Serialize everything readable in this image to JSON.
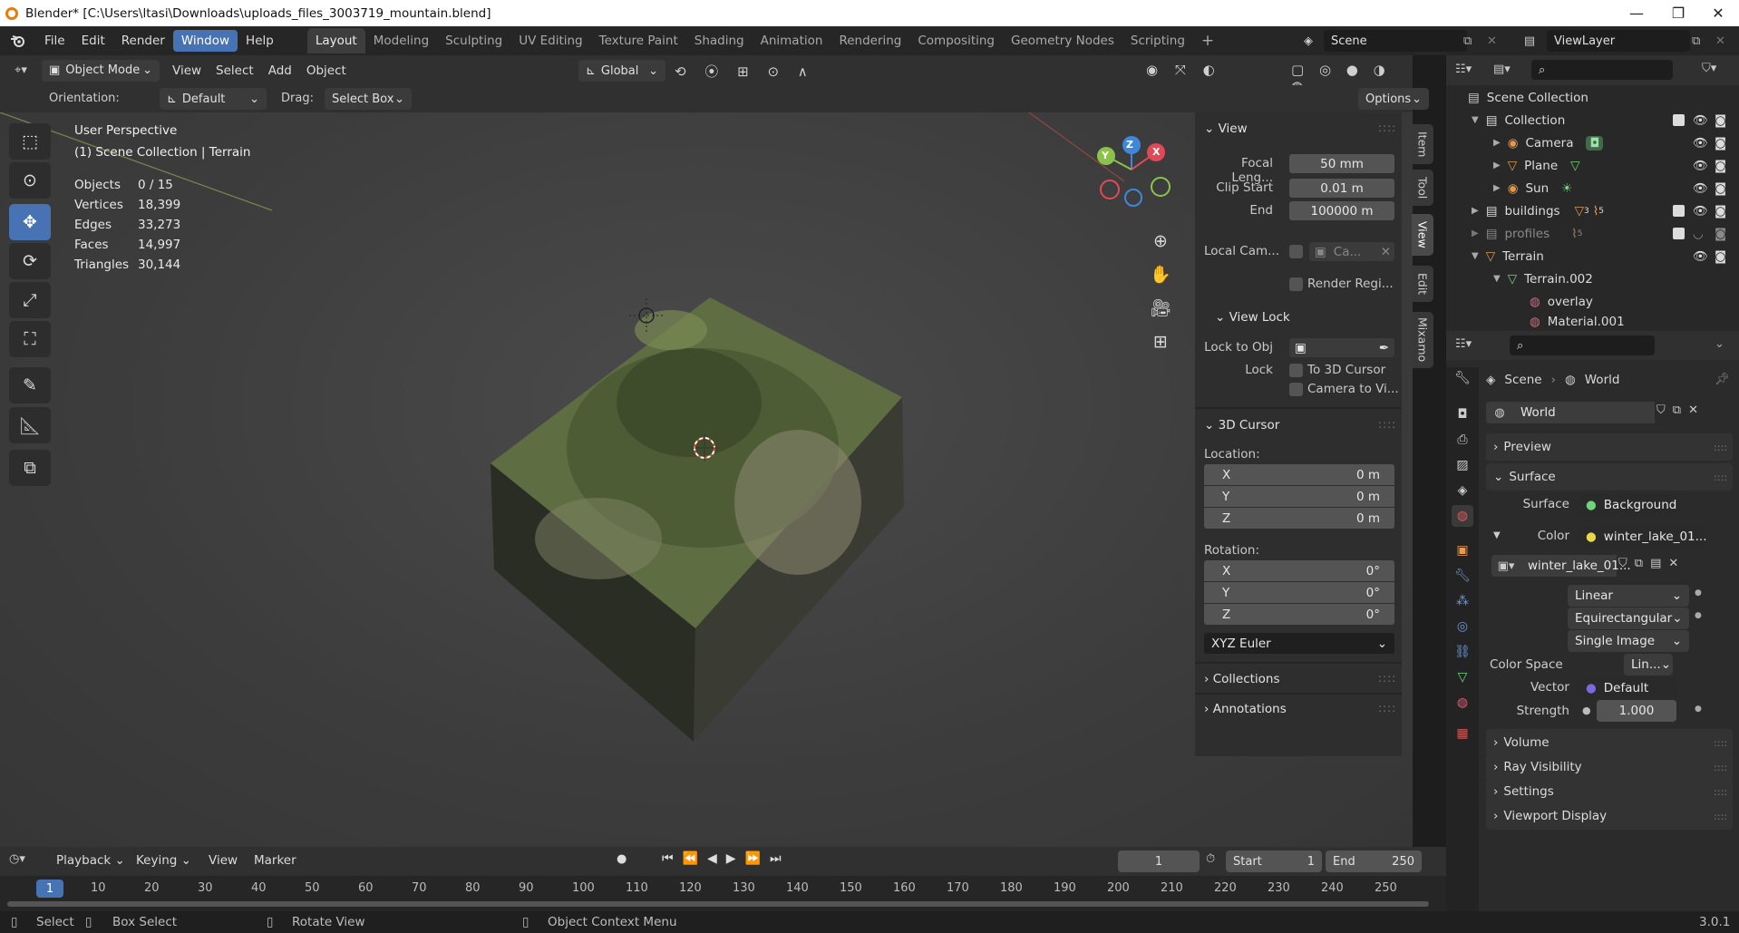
{
  "titlebar": {
    "title": "Blender* [C:\\Users\\ltasi\\Downloads\\uploads_files_3003719_mountain.blend]",
    "min": "—",
    "max": "❐",
    "close": "✕"
  },
  "menu": [
    "File",
    "Edit",
    "Render",
    "Window",
    "Help"
  ],
  "menu_active": "Window",
  "workspaces": [
    "Layout",
    "Modeling",
    "Sculpting",
    "UV Editing",
    "Texture Paint",
    "Shading",
    "Animation",
    "Rendering",
    "Compositing",
    "Geometry Nodes",
    "Scripting"
  ],
  "workspace_add": "+",
  "scene_name": "Scene",
  "view_layer": "ViewLayer",
  "vp_header": {
    "mode": "Object Mode",
    "view": "View",
    "select": "Select",
    "add": "Add",
    "object": "Object",
    "transform": "Global"
  },
  "vp_header2": {
    "orientation_label": "Orientation:",
    "orientation": "Default",
    "drag_label": "Drag:",
    "drag": "Select Box",
    "options": "Options"
  },
  "overlay": {
    "perspective": "User Perspective",
    "collection": "(1) Scene Collection | Terrain",
    "stats": [
      {
        "label": "Objects",
        "value": "0 / 15"
      },
      {
        "label": "Vertices",
        "value": "18,399"
      },
      {
        "label": "Edges",
        "value": "33,273"
      },
      {
        "label": "Faces",
        "value": "14,997"
      },
      {
        "label": "Triangles",
        "value": "30,144"
      }
    ]
  },
  "gizmo": {
    "x": "X",
    "y": "Y",
    "z": "Z"
  },
  "npanel": {
    "view_title": "View",
    "focal_label": "Focal Leng...",
    "focal_value": "50 mm",
    "clip_start_label": "Clip Start",
    "clip_start_value": "0.01 m",
    "clip_end_label": "End",
    "clip_end_value": "100000 m",
    "local_cam_label": "Local Cam...",
    "local_cam_value": "Ca...",
    "render_region": "Render Regi...",
    "view_lock_title": "View Lock",
    "lock_obj_label": "Lock to Obj",
    "lock_label": "Lock",
    "to_cursor": "To 3D Cursor",
    "camera_to_view": "Camera to Vi...",
    "cursor_title": "3D Cursor",
    "location_label": "Location:",
    "loc": [
      {
        "axis": "X",
        "value": "0 m"
      },
      {
        "axis": "Y",
        "value": "0 m"
      },
      {
        "axis": "Z",
        "value": "0 m"
      }
    ],
    "rotation_label": "Rotation:",
    "rot": [
      {
        "axis": "X",
        "value": "0°"
      },
      {
        "axis": "Y",
        "value": "0°"
      },
      {
        "axis": "Z",
        "value": "0°"
      }
    ],
    "rot_mode": "XYZ Euler",
    "collections": "Collections",
    "annotations": "Annotations",
    "tabs": [
      "Item",
      "Tool",
      "View",
      "Edit",
      "Mixamo"
    ]
  },
  "outliner": {
    "root": "Scene Collection",
    "rows": [
      {
        "name": "Collection",
        "indent": 1
      },
      {
        "name": "Camera",
        "indent": 2
      },
      {
        "name": "Plane",
        "indent": 2
      },
      {
        "name": "Sun",
        "indent": 2
      },
      {
        "name": "buildings",
        "indent": 1
      },
      {
        "name": "profiles",
        "indent": 1
      },
      {
        "name": "Terrain",
        "indent": 1
      },
      {
        "name": "Terrain.002",
        "indent": 2
      },
      {
        "name": "overlay",
        "indent": 3
      },
      {
        "name": "Material.001",
        "indent": 3
      }
    ],
    "buildings_counts": [
      "3",
      "5"
    ],
    "profiles_count": "5"
  },
  "props": {
    "breadcrumb_scene": "Scene",
    "breadcrumb_world": "World",
    "world_name": "World",
    "preview": "Preview",
    "surface_section": "Surface",
    "surface_label": "Surface",
    "surface_value": "Background",
    "color_label": "Color",
    "color_value": "winter_lake_01...",
    "image_name": "winter_lake_01...",
    "interp": "Linear",
    "projection": "Equirectangular",
    "source": "Single Image",
    "colorspace_label": "Color Space",
    "colorspace_value": "Lin...",
    "vector_label": "Vector",
    "vector_value": "Default",
    "strength_label": "Strength",
    "strength_value": "1.000",
    "volume": "Volume",
    "ray_visibility": "Ray Visibility",
    "settings": "Settings",
    "viewport_display": "Viewport Display"
  },
  "timeline": {
    "menus": [
      "Playback",
      "Keying",
      "View",
      "Marker"
    ],
    "current_frame": "1",
    "start_label": "Start",
    "start": "1",
    "end_label": "End",
    "end": "250",
    "ruler": [
      "1",
      "10",
      "20",
      "30",
      "40",
      "50",
      "60",
      "70",
      "80",
      "90",
      "100",
      "110",
      "120",
      "130",
      "140",
      "150",
      "160",
      "170",
      "180",
      "190",
      "200",
      "210",
      "220",
      "230",
      "240",
      "250"
    ]
  },
  "status": {
    "select": "Select",
    "box_select": "Box Select",
    "rotate": "Rotate View",
    "context": "Object Context Menu",
    "version": "3.0.1"
  },
  "colors": {
    "accent": "#4772b3",
    "terrain": "#5d6b3f",
    "x_axis": "#e04a57",
    "y_axis": "#8bc34a",
    "z_axis": "#3f87d8"
  }
}
